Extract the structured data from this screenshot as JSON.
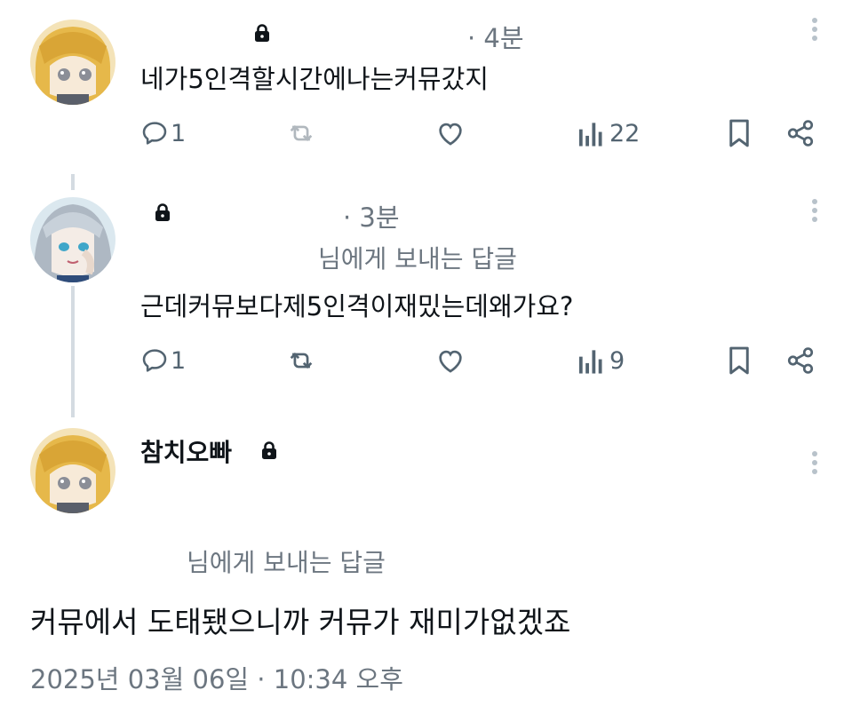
{
  "tweets": [
    {
      "time": "· 4분",
      "text": "네가5인격할시간에나는커뮤갔지",
      "actions": {
        "reply_count": "1",
        "views_count": "22"
      }
    },
    {
      "time": "· 3분",
      "reply_to": "님에게 보내는 답글",
      "text": "근데커뮤보다제5인격이재밌는데왜가요?",
      "actions": {
        "reply_count": "1",
        "views_count": "9"
      }
    }
  ],
  "main_tweet": {
    "author": "참치오빠",
    "reply_to": "님에게 보내는 답글",
    "text": "커뮤에서 도태됐으니까 커뮤가 재미가없겠죠",
    "timestamp": "2025년 03월 06일 · 10:34 오후"
  },
  "icons": {
    "reply": "reply-icon",
    "retweet": "retweet-icon",
    "like": "heart-icon",
    "views": "views-icon",
    "bookmark": "bookmark-icon",
    "share": "share-icon",
    "lock": "lock-icon",
    "more": "more-icon"
  },
  "colors": {
    "text": "#0f1419",
    "muted": "#6c7680",
    "icon": "#536471",
    "divider": "#d4dbe1"
  }
}
